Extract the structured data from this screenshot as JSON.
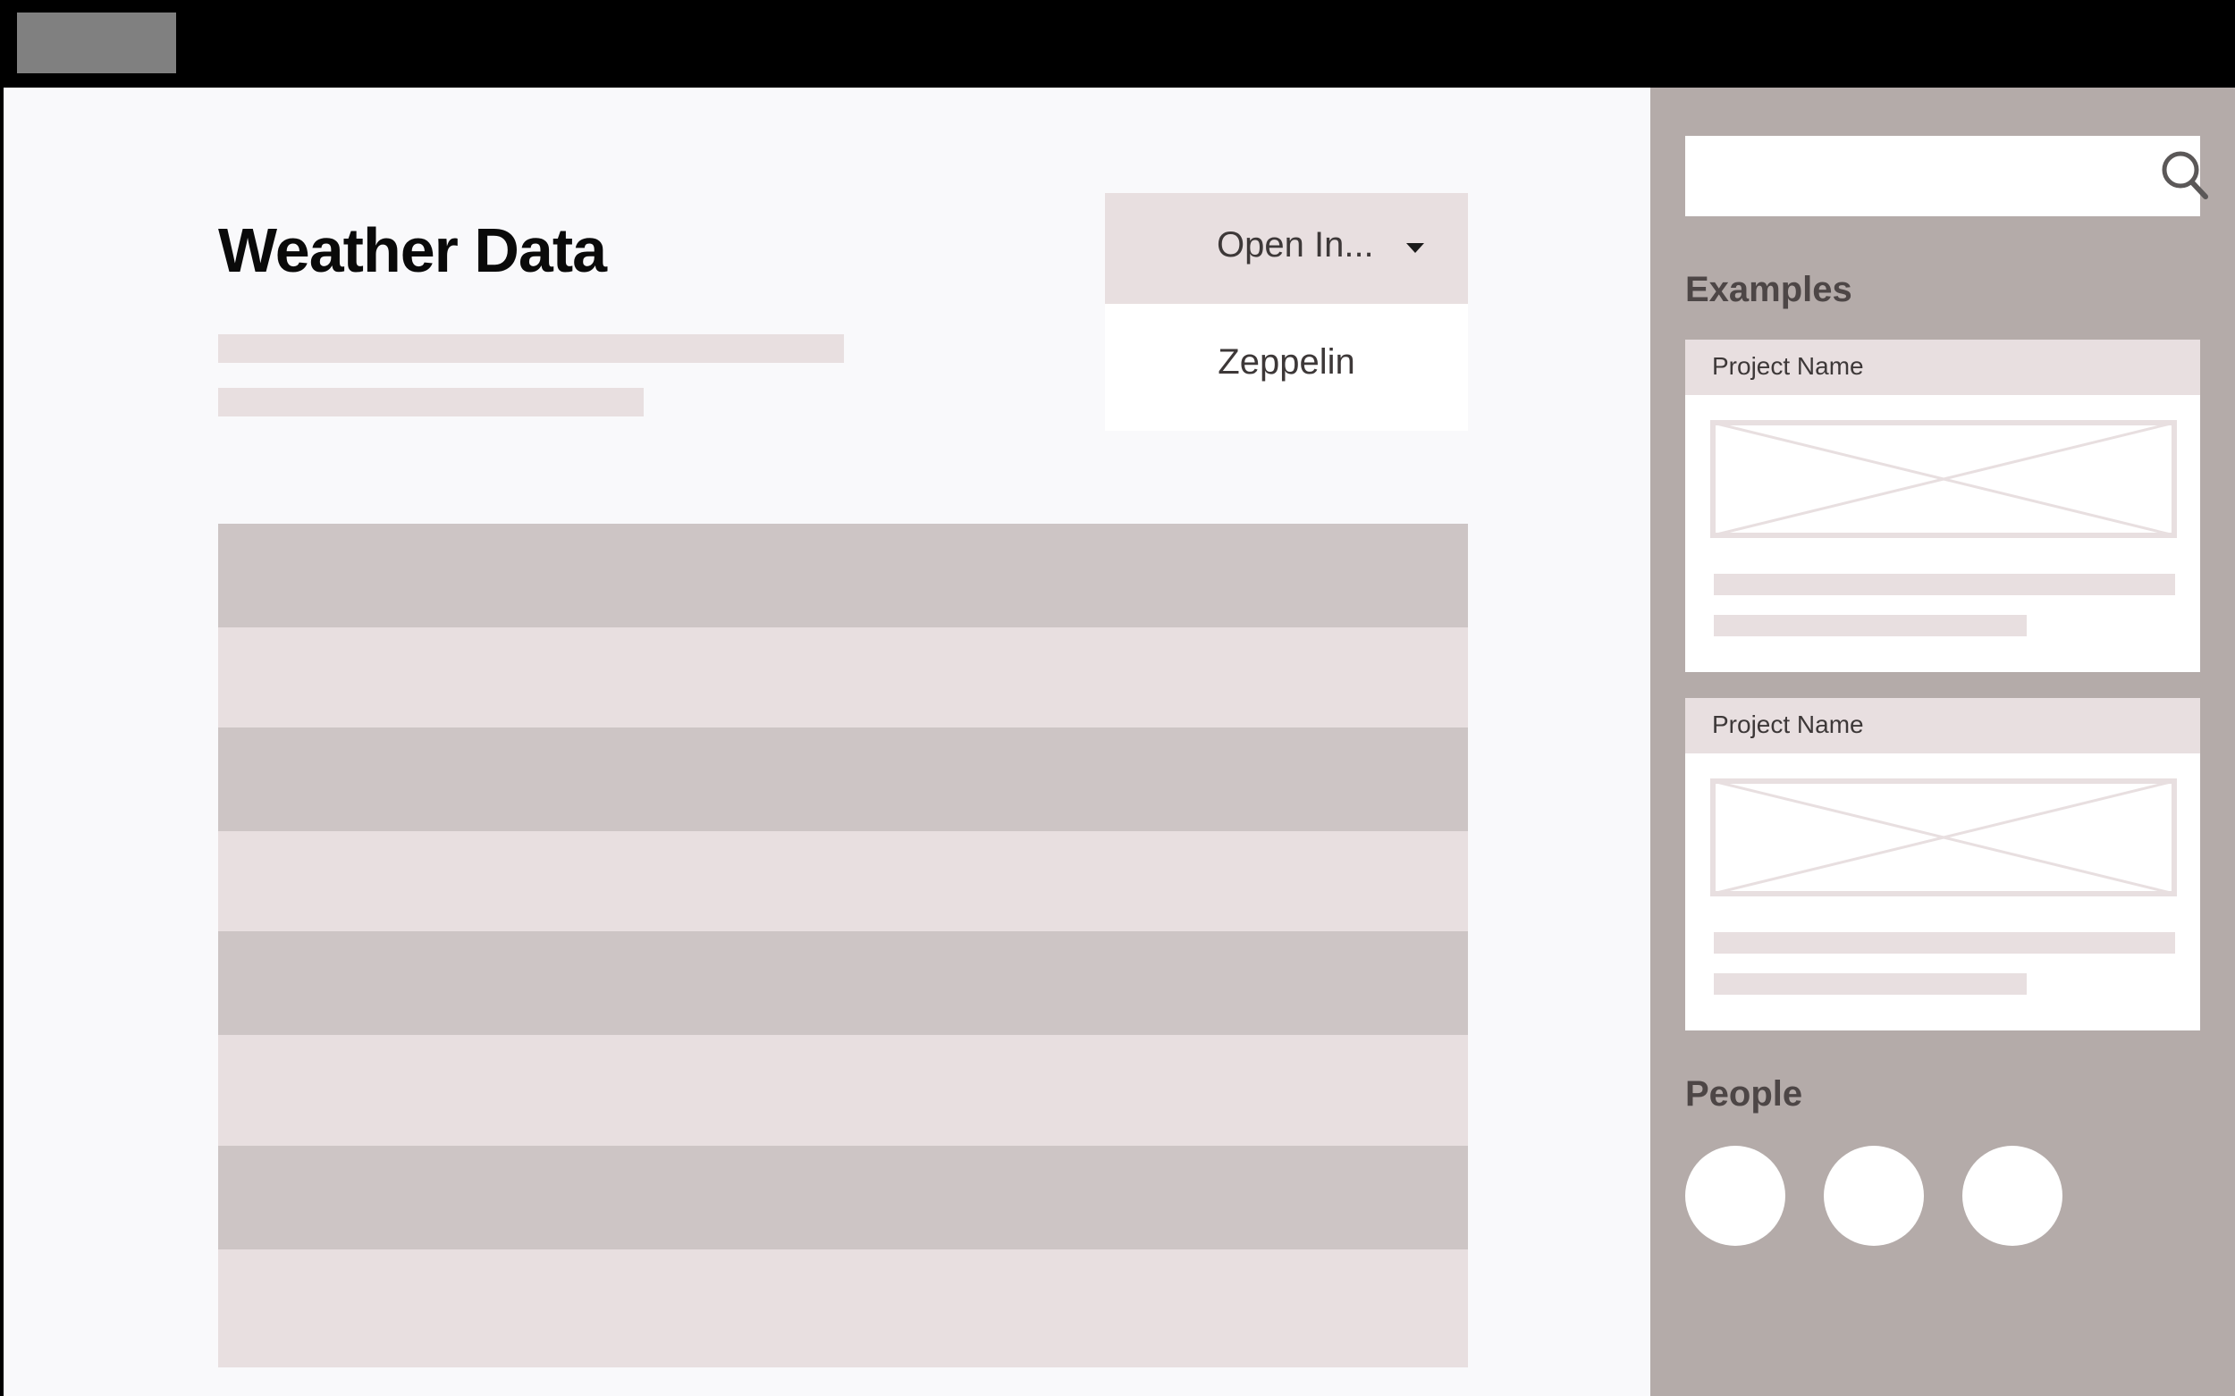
{
  "header": {
    "title": "Weather Data"
  },
  "open_in": {
    "label": "Open In...",
    "options": [
      "Zeppelin"
    ]
  },
  "sidebar": {
    "search": {
      "placeholder": ""
    },
    "examples_heading": "Examples",
    "examples": [
      {
        "title": "Project Name"
      },
      {
        "title": "Project Name"
      }
    ],
    "people_heading": "People"
  },
  "colors": {
    "top_bar": "#000000",
    "page_background": "#f9f9fb",
    "sidebar_background": "#b4aba9",
    "row_dark": "#cdc5c5",
    "row_light": "#e8dfe0"
  }
}
